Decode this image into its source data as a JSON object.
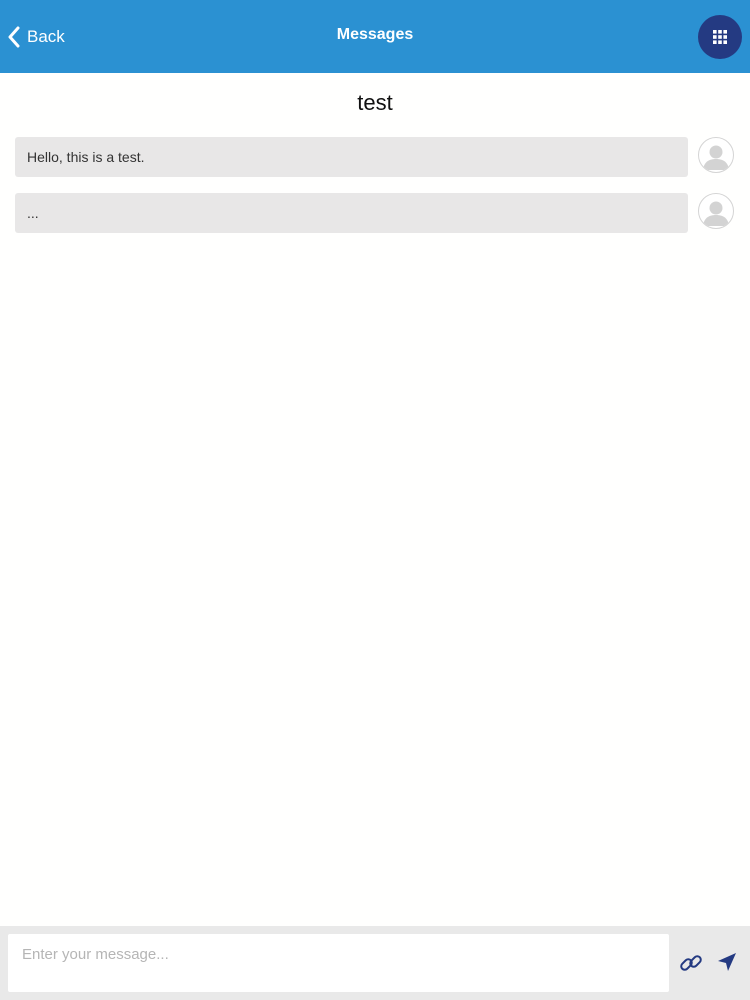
{
  "header": {
    "back_label": "Back",
    "title": "Messages",
    "background_color": "#2b91d2",
    "menu_button_color": "#243a82",
    "menu_icon": "grid-icon"
  },
  "conversation": {
    "title": "test",
    "messages": [
      {
        "text": "Hello, this is a test.",
        "avatar": "user-avatar-icon"
      },
      {
        "text": "...",
        "avatar": "user-avatar-icon"
      }
    ]
  },
  "composer": {
    "placeholder": "Enter your message...",
    "value": "",
    "attach_icon": "link-icon",
    "send_icon": "send-icon",
    "icon_color": "#243a82"
  }
}
